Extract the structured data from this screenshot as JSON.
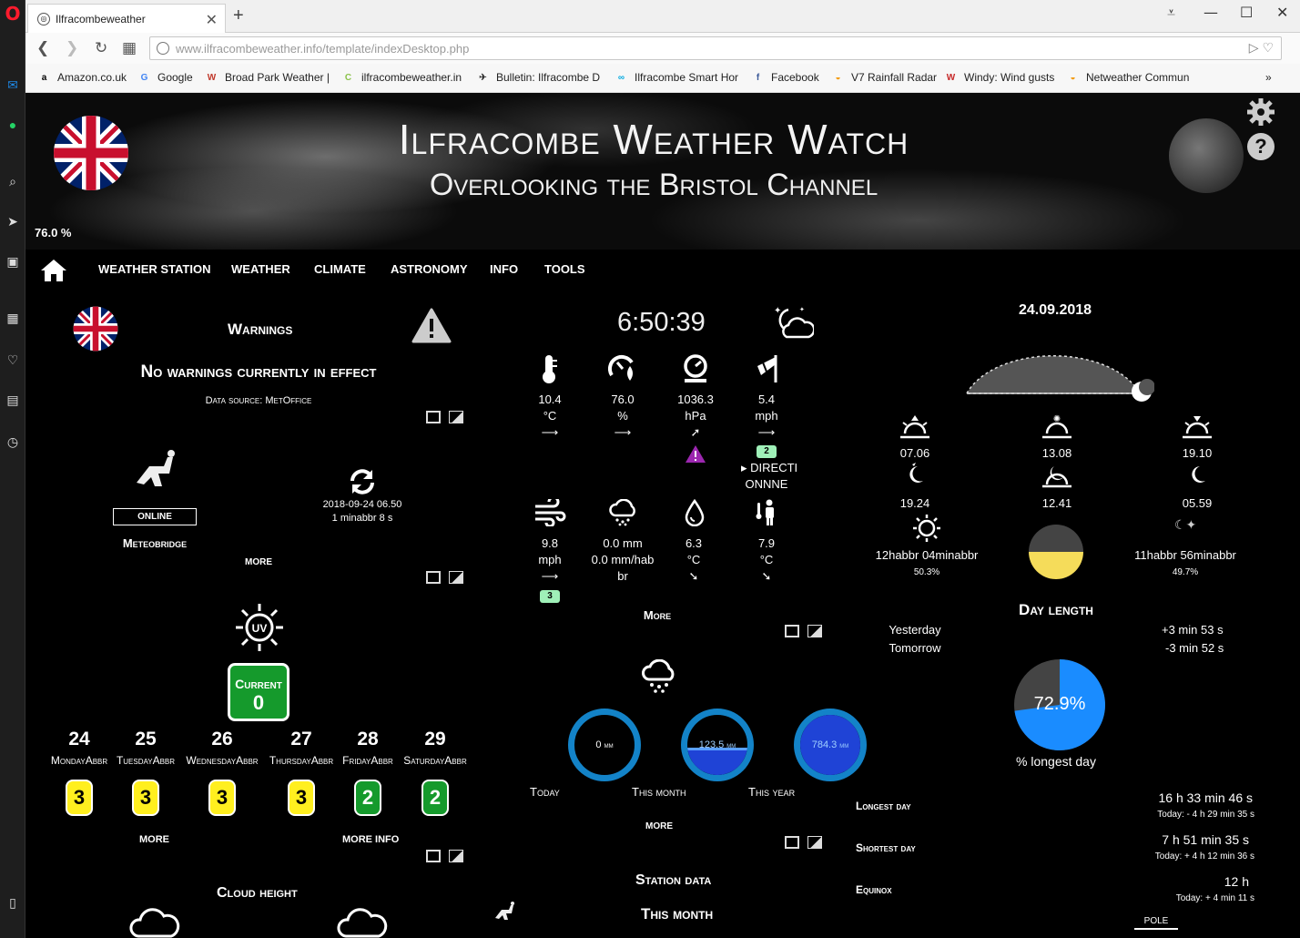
{
  "browser": {
    "tab_title": "Ilfracombeweather",
    "url_domain": "www.ilfracombeweather.info",
    "url_path": "/template/indexDesktop.php",
    "bookmarks": [
      {
        "label": "Amazon.co.uk",
        "icon": "a",
        "color": "#000000"
      },
      {
        "label": "Google",
        "icon": "G",
        "color": "#4285f4"
      },
      {
        "label": "Broad Park Weather |",
        "icon": "W",
        "color": "#c0392b"
      },
      {
        "label": "ilfracombeweather.in",
        "icon": "C",
        "color": "#8bc34a"
      },
      {
        "label": "Bulletin: Ilfracombe D",
        "icon": "✈",
        "color": "#333333"
      },
      {
        "label": "Ilfracombe Smart Hor",
        "icon": "∞",
        "color": "#00a9e0"
      },
      {
        "label": "Facebook",
        "icon": "f",
        "color": "#3b5998"
      },
      {
        "label": "V7 Rainfall Radar",
        "icon": "◒",
        "color": "#f39c12"
      },
      {
        "label": "Windy: Wind gusts",
        "icon": "W",
        "color": "#c62828"
      },
      {
        "label": "Netweather Commun",
        "icon": "◒",
        "color": "#f39c12"
      }
    ]
  },
  "header": {
    "title": "Ilfracombe Weather Watch",
    "subtitle": "Overlooking the Bristol Channel",
    "humidity": "76.0 %"
  },
  "menu": [
    "WEATHER STATION",
    "WEATHER",
    "CLIMATE",
    "ASTRONOMY",
    "INFO",
    "TOOLS"
  ],
  "warnings": {
    "title": "Warnings",
    "message": "No warnings currently in effect",
    "source": "Data source: MetOffice"
  },
  "station": {
    "status": "ONLINE",
    "name": "Meteobridge",
    "updated": "2018-09-24 06.50",
    "ago": "1 minabbr 8 s",
    "more": "MORE"
  },
  "uv": {
    "current_label": "Current",
    "current_value": "0",
    "days": [
      {
        "date": "24",
        "day": "MondayAbbr",
        "value": "3",
        "level": "yellow"
      },
      {
        "date": "25",
        "day": "TuesdayAbbr",
        "value": "3",
        "level": "yellow"
      },
      {
        "date": "26",
        "day": "WednesdayAbbr",
        "value": "3",
        "level": "yellow"
      },
      {
        "date": "27",
        "day": "ThursdayAbbr",
        "value": "3",
        "level": "yellow"
      },
      {
        "date": "28",
        "day": "FridayAbbr",
        "value": "2",
        "level": "green"
      },
      {
        "date": "29",
        "day": "SaturdayAbbr",
        "value": "2",
        "level": "green"
      }
    ],
    "more": "MORE",
    "more_info": "MORE INFO"
  },
  "cloud": {
    "title": "Cloud height"
  },
  "current": {
    "time": "6:50:39",
    "temperature": {
      "value": "10.4",
      "unit": "°C"
    },
    "humidity": {
      "value": "76.0",
      "unit": "%"
    },
    "pressure": {
      "value": "1036.3",
      "unit": "hPa"
    },
    "wind": {
      "value": "5.4",
      "unit": "mph",
      "badge": "2",
      "direction_l1": "DIRECTI",
      "direction_l2": "ONNNE"
    },
    "gust": {
      "value": "9.8",
      "unit": "mph",
      "badge": "3"
    },
    "rain": {
      "line1": "0.0 mm",
      "line2": "0.0 mm/hab",
      "line3": "br"
    },
    "dewpoint": {
      "value": "6.3",
      "unit": "°C"
    },
    "feels": {
      "value": "7.9",
      "unit": "°C"
    },
    "more": "More"
  },
  "rain": {
    "today": {
      "value": "0",
      "unit": "mm",
      "label": "Today",
      "fill": 0.0
    },
    "month": {
      "value": "123.5",
      "unit": "mm",
      "label": "This month",
      "fill": 0.45
    },
    "year": {
      "value": "784.3",
      "unit": "mm",
      "label": "This year",
      "fill": 1.0
    },
    "more": "MORE"
  },
  "station_data": {
    "title": "Station data",
    "subtitle": "This month"
  },
  "astronomy": {
    "date": "24.09.2018",
    "sunrise": "07.06",
    "solar_noon": "13.08",
    "sunset": "19.10",
    "moonrise_prev": "19.24",
    "moon_transit": "12.41",
    "moonset": "05.59",
    "daylight": "12habbr 04minabbr",
    "daylight_pct": "50.3%",
    "darkness": "11habbr 56minabbr",
    "darkness_pct": "49.7%",
    "day_length_title": "Day length",
    "yesterday_label": "Yesterday",
    "tomorrow_label": "Tomorrow",
    "yesterday_diff": "+3 min 53 s",
    "tomorrow_diff": "-3 min 52 s",
    "longest_pct": "72.9%",
    "longest_pct_value": 72.9,
    "longest_label": "% longest day",
    "longest_day_label": "Longest day",
    "longest_day_value": "16 h 33 min 46 s",
    "longest_day_today": "Today: - 4 h 29 min 35 s",
    "shortest_day_label": "Shortest day",
    "shortest_day_value": "7 h 51 min 35 s",
    "shortest_day_today": "Today: + 4 h 12 min 36 s",
    "equinox_label": "Equinox",
    "equinox_value": "12 h",
    "equinox_today": "Today: + 4 min 11 s",
    "pole_label": "POLE"
  },
  "colors": {
    "online": "#159a2c",
    "uv_yellow": "#ffef1f",
    "uv_green": "#159a2c",
    "rain_ring": "#1383c8",
    "pie_blue": "#1a8cff",
    "pie_grey": "#444444"
  }
}
